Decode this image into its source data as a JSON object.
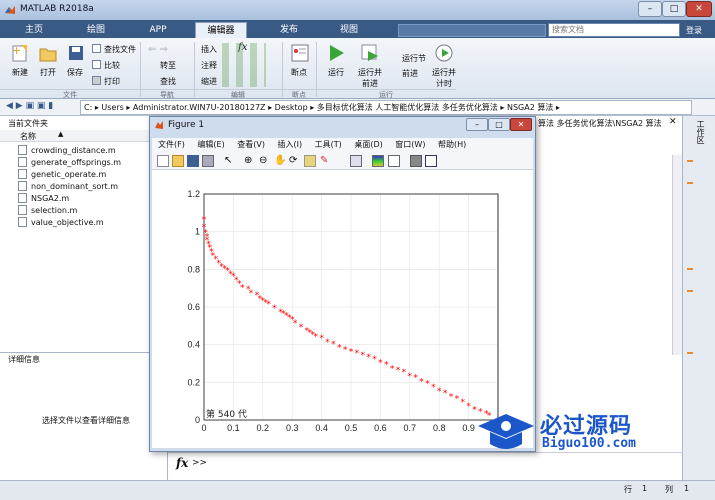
{
  "window_title": "MATLAB R2018a",
  "search": {
    "placeholder": "搜索文档",
    "login": "登录"
  },
  "tabs": [
    "主页",
    "绘图",
    "APP",
    "编辑器",
    "发布",
    "视图"
  ],
  "ribbon": {
    "new": "新建",
    "open": "打开",
    "save": "保存",
    "find_files": "查找文件",
    "compare": "比较",
    "print": "打印",
    "goto": "转至",
    "find": "查找",
    "insert": "插入",
    "comment": "注释",
    "indent": "缩进",
    "breakpoint": "断点",
    "run": "运行",
    "run_advance": "运行并\n前进",
    "run_section": "运行节",
    "advance": "前进",
    "run_time": "运行并\n计时",
    "sections": [
      "文件",
      "导航",
      "编辑",
      "断点",
      "运行"
    ]
  },
  "address": {
    "crumbs": [
      "C:",
      "Users",
      "Administrator.WIN7U-20180127Z",
      "Desktop",
      "多目标优化算法 人工智能优化算法 多任务优化算法",
      "NSGA2 算法"
    ]
  },
  "current_folder": {
    "title": "当前文件夹",
    "col_name": "名称",
    "files": [
      "crowding_distance.m",
      "generate_offsprings.m",
      "genetic_operate.m",
      "non_dominant_sort.m",
      "NSGA2.m",
      "selection.m",
      "value_objective.m"
    ]
  },
  "details": {
    "title": "详细信息",
    "hint": "选择文件以查看详细信息"
  },
  "editor_path": "算法 多任务优化算法\\NSGA2 算法",
  "right_panel": "工作区",
  "command": {
    "fx": "fx",
    "prompt": ">>"
  },
  "status": {
    "row_label": "行",
    "row": "1",
    "col_label": "列",
    "col": "1"
  },
  "figure": {
    "title": "Figure 1",
    "menu": [
      "文件(F)",
      "编辑(E)",
      "查看(V)",
      "插入(I)",
      "工具(T)",
      "桌面(D)",
      "窗口(W)",
      "帮助(H)"
    ],
    "annotation": "第 540 代"
  },
  "watermark": {
    "cn": "必过源码",
    "url": "Biguo100.com"
  },
  "chart_data": {
    "type": "scatter",
    "marker": "*",
    "color": "#ff0000",
    "xlim": [
      0,
      1
    ],
    "ylim": [
      0,
      1.2
    ],
    "xticks": [
      "0",
      "0.1",
      "0.2",
      "0.3",
      "0.4",
      "0.5",
      "0.6",
      "0.7",
      "0.8",
      "0.9"
    ],
    "yticks": [
      "0",
      "0.2",
      "0.4",
      "0.6",
      "0.8",
      "1",
      "1.2"
    ],
    "grid": true,
    "x": [
      0.0,
      0.0,
      0.005,
      0.01,
      0.01,
      0.015,
      0.02,
      0.025,
      0.03,
      0.04,
      0.05,
      0.06,
      0.07,
      0.08,
      0.09,
      0.1,
      0.11,
      0.12,
      0.13,
      0.15,
      0.16,
      0.18,
      0.19,
      0.2,
      0.21,
      0.22,
      0.24,
      0.26,
      0.27,
      0.28,
      0.29,
      0.3,
      0.31,
      0.33,
      0.35,
      0.36,
      0.37,
      0.38,
      0.4,
      0.42,
      0.44,
      0.46,
      0.48,
      0.5,
      0.52,
      0.54,
      0.56,
      0.58,
      0.6,
      0.62,
      0.64,
      0.66,
      0.68,
      0.7,
      0.72,
      0.74,
      0.76,
      0.78,
      0.8,
      0.82,
      0.84,
      0.86,
      0.88,
      0.9,
      0.92,
      0.94,
      0.96,
      0.97
    ],
    "y": [
      1.07,
      1.03,
      1.0,
      0.98,
      0.96,
      0.94,
      0.92,
      0.9,
      0.88,
      0.86,
      0.84,
      0.82,
      0.81,
      0.8,
      0.78,
      0.77,
      0.75,
      0.73,
      0.71,
      0.7,
      0.68,
      0.67,
      0.65,
      0.64,
      0.63,
      0.62,
      0.6,
      0.58,
      0.57,
      0.56,
      0.55,
      0.54,
      0.52,
      0.5,
      0.48,
      0.47,
      0.46,
      0.45,
      0.44,
      0.42,
      0.41,
      0.39,
      0.38,
      0.37,
      0.36,
      0.35,
      0.34,
      0.33,
      0.31,
      0.3,
      0.28,
      0.27,
      0.26,
      0.24,
      0.23,
      0.21,
      0.2,
      0.18,
      0.16,
      0.15,
      0.13,
      0.12,
      0.1,
      0.08,
      0.06,
      0.05,
      0.04,
      0.03
    ]
  }
}
